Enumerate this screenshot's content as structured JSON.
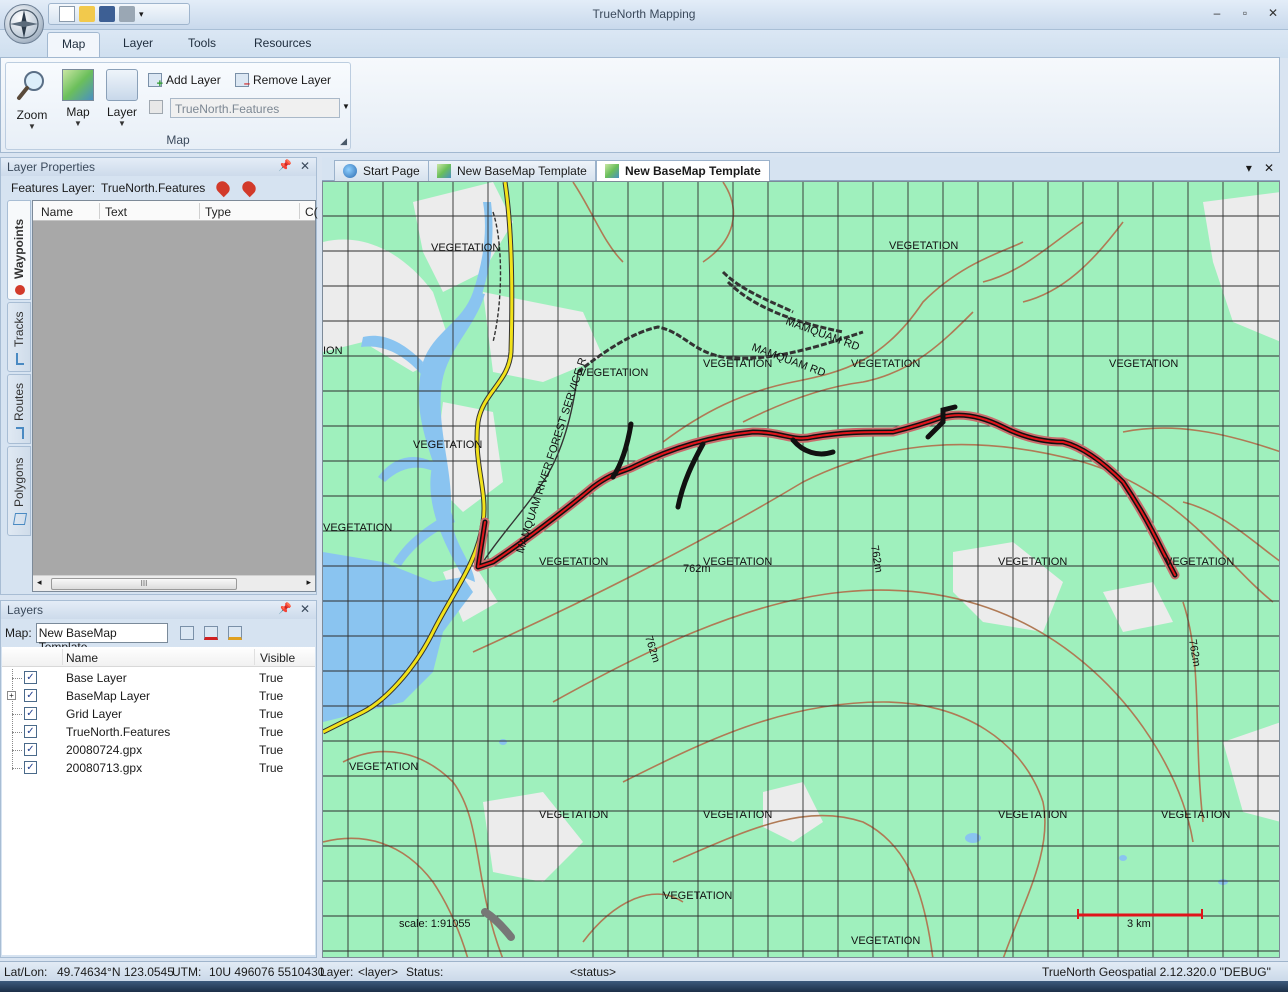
{
  "window": {
    "title": "TrueNorth Mapping",
    "buttons": [
      "–",
      "▫",
      "✕"
    ]
  },
  "ribbon": {
    "tabs": [
      "Map",
      "Layer",
      "Tools",
      "Resources"
    ],
    "active_tab": "Map",
    "group_label": "Map",
    "zoom_label": "Zoom",
    "map_label": "Map",
    "layer_label": "Layer",
    "add_layer": "Add Layer",
    "remove_layer": "Remove Layer",
    "feature_combo": "TrueNorth.Features"
  },
  "layer_properties": {
    "title": "Layer Properties",
    "features_layer_label": "Features Layer:",
    "features_layer_value": "TrueNorth.Features",
    "columns": [
      "Name",
      "Text",
      "Type",
      "C("
    ],
    "side_tabs": [
      "Waypoints",
      "Tracks",
      "Routes",
      "Polygons"
    ],
    "scroll_grip": "III"
  },
  "layers_panel": {
    "title": "Layers",
    "map_label": "Map:",
    "map_value": "New BaseMap Template",
    "columns": [
      "Name",
      "Visible"
    ],
    "rows": [
      {
        "name": "Base Layer",
        "visible": "True"
      },
      {
        "name": "BaseMap Layer",
        "visible": "True"
      },
      {
        "name": "Grid Layer",
        "visible": "True"
      },
      {
        "name": "TrueNorth.Features",
        "visible": "True"
      },
      {
        "name": "20080724.gpx",
        "visible": "True"
      },
      {
        "name": "20080713.gpx",
        "visible": "True"
      }
    ]
  },
  "doc_tabs": [
    "Start Page",
    "New BaseMap Template",
    "New BaseMap Template"
  ],
  "map": {
    "labels": {
      "veg": "VEGETATION",
      "veg_partial": "VEGETATION",
      "ion": "ION",
      "road1": "MAMQUAM RD",
      "road2": "MAMQUAM RD",
      "forest_service": "MAMQUAM RIVER FOREST SERVICE R",
      "contour": "762m",
      "contour_rot": "762m"
    },
    "scale": "scale: 1:91055",
    "scalebar": "3 km",
    "colors": {
      "land": "#9ff0bd",
      "water": "#8ac4f0",
      "contour": "#b07a55",
      "track": "#e0141a",
      "grid": "#4a4a4a",
      "highway": "#f2e21a"
    }
  },
  "statusbar": {
    "latlon_label": "Lat/Lon:",
    "latlon_value": "49.74634°N 123.0545",
    "utm_label": "UTM:",
    "utm_value": "10U 496076 5510430",
    "layer_label": "Layer:",
    "layer_value": "<layer>",
    "status_label": "Status:",
    "status_value": "<status>",
    "version": "TrueNorth Geospatial 2.12.320.0 \"DEBUG\""
  }
}
